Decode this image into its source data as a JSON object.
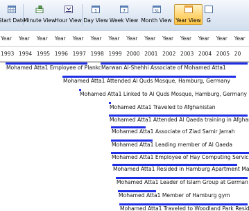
{
  "toolbar": {
    "buttons": [
      {
        "label": "Start Date"
      },
      {
        "label": "Minute View"
      },
      {
        "label": "Hour View"
      },
      {
        "label": "Day View"
      },
      {
        "label": "Week View"
      },
      {
        "label": "Month View"
      },
      {
        "label": "Year View"
      },
      {
        "label": "G"
      }
    ],
    "active_button": "Year View",
    "accent_color": "#ffc545"
  },
  "timeline": {
    "header_label": "Year",
    "years": [
      "1993",
      "1994",
      "1995",
      "1996",
      "1997",
      "1998",
      "1999",
      "2000",
      "2001",
      "2002",
      "2003",
      "2004",
      "2005",
      "20"
    ]
  },
  "events": [
    {
      "label": "Mohamed Atta1 Employee of Plankontor"
    },
    {
      "label": "Marwan Al-Shehhi Associate of Mohamed Atta1"
    },
    {
      "label": "Mohamed Atta1 Attended Al Quds Mosque, Hamburg, Germany"
    },
    {
      "label": "Mohamed Atta1 Linked to Al Quds Mosque, Hamburg, Germany"
    },
    {
      "label": "Mohamed Atta1 Traveled to Afghanistan"
    },
    {
      "label": "Mohamed Atta1 Attended Al Qaeda training in Afghani"
    },
    {
      "label": "Mohamed Atta1 Associate of Ziad Samir Jarrah"
    },
    {
      "label": "Mohamed Atta1 Leading member of Al Qaeda"
    },
    {
      "label": "Mohamed Atta1 Employee of Hay Computing Servic"
    },
    {
      "label": "Mohamed Atta1 Resided in Hamburg Apartment Mar"
    },
    {
      "label": "Mohamed Atta1 Leader of Islam Group at German U"
    },
    {
      "label": "Mohamed Atta1 Member of Hamburg gym"
    },
    {
      "label": "Mohamed Atta1 Traveled to Woodland Park Resid"
    }
  ],
  "colors": {
    "event_bar": "#1f2fe6"
  }
}
